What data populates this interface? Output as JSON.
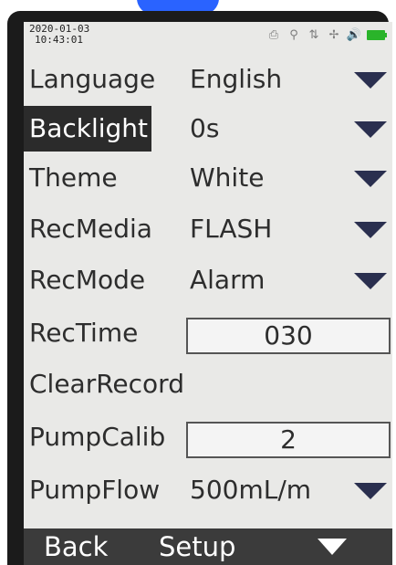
{
  "status": {
    "date": "2020-01-03",
    "time": "10:43:01",
    "icons": [
      "printer-icon",
      "person-icon",
      "signal-icon",
      "fan-icon",
      "volume-icon",
      "battery-icon"
    ]
  },
  "rows": [
    {
      "label": "Language",
      "value": "English",
      "type": "dropdown"
    },
    {
      "label": "Backlight",
      "value": "0s",
      "type": "dropdown"
    },
    {
      "label": "Theme",
      "value": "White",
      "type": "dropdown"
    },
    {
      "label": "RecMedia",
      "value": "FLASH",
      "type": "dropdown"
    },
    {
      "label": "RecMode",
      "value": "Alarm",
      "type": "dropdown"
    },
    {
      "label": "RecTime",
      "value": "030",
      "type": "field"
    },
    {
      "label": "ClearRecord",
      "value": "",
      "type": "action"
    },
    {
      "label": "PumpCalib",
      "value": "2",
      "type": "field"
    },
    {
      "label": "PumpFlow",
      "value": "500mL/m",
      "type": "dropdown"
    }
  ],
  "softkeys": {
    "left": "Back",
    "middle": "Setup",
    "right": "down-arrow-icon"
  }
}
